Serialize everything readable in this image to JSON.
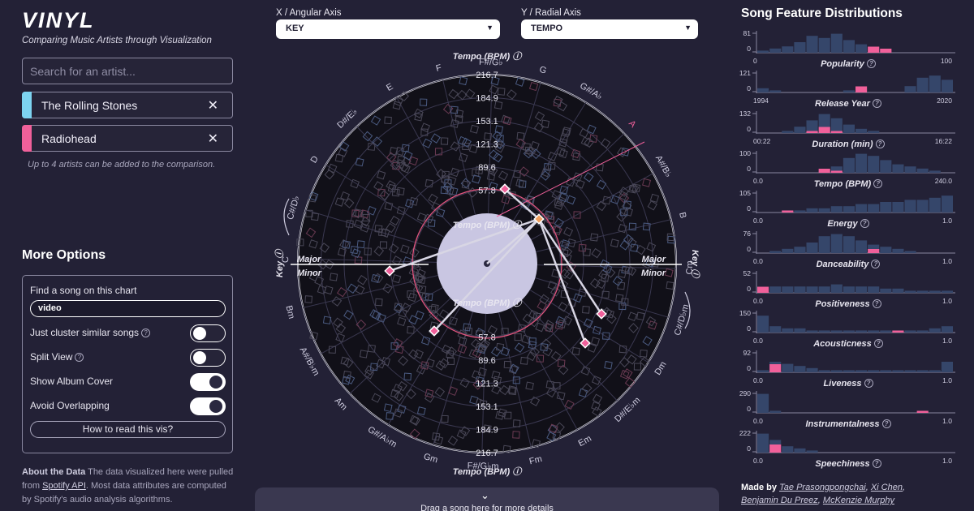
{
  "app": {
    "title": "VINYL",
    "subtitle": "Comparing Music Artists through Visualization"
  },
  "search": {
    "placeholder": "Search for an artist..."
  },
  "artists": [
    {
      "name": "The Rolling Stones",
      "color": "#7dd3f0",
      "remove": "✕"
    },
    {
      "name": "Radiohead",
      "color": "#f0609a",
      "remove": "✕"
    }
  ],
  "artist_hint": "Up to 4 artists can be added to the comparison.",
  "options": {
    "title": "More Options",
    "find_label": "Find a song on this chart",
    "find_value": "video",
    "toggles": [
      {
        "label": "Just cluster similar songs",
        "on": false,
        "help": true
      },
      {
        "label": "Split View",
        "on": false,
        "help": true
      },
      {
        "label": "Show Album Cover",
        "on": true,
        "help": false
      },
      {
        "label": "Avoid Overlapping",
        "on": true,
        "help": false
      }
    ],
    "how_button": "How to read this vis?"
  },
  "about": {
    "heading": "About the Data",
    "text1": "The data visualized here were pulled from",
    "link": "Spotify API",
    "text2": ". Most data attributes are computed by Spotify's audio analysis algorithms."
  },
  "axes": {
    "x_label": "X / Angular Axis",
    "x_value": "KEY",
    "y_label": "Y / Radial Axis",
    "y_value": "TEMPO"
  },
  "chart_data": {
    "type": "scatter",
    "radial_axis": "Tempo (BPM)",
    "angular_axis": "Key",
    "radial_ticks": [
      "57.8",
      "89.6",
      "121.3",
      "153.1",
      "184.9",
      "216.7"
    ],
    "keys": [
      "F#/G♭",
      "G",
      "G#/A♭",
      "A",
      "A#/B♭",
      "B",
      "Cm",
      "C#/D♭m",
      "Dm",
      "D#/E♭m",
      "Em",
      "Fm",
      "F#/G♭m",
      "Gm",
      "G#/A♭m",
      "Am",
      "A#/B♭m",
      "Bm",
      "C",
      "C#/D♭",
      "D",
      "D#/E♭",
      "E",
      "F"
    ],
    "highlighted_key": "A",
    "mode_labels": {
      "major": "Major",
      "minor": "Minor"
    },
    "axis_title": "Key"
  },
  "bottom_panel": {
    "chevron": "⌄",
    "text": "Drag a song here for more details"
  },
  "distributions": {
    "title": "Song Feature Distributions",
    "items": [
      {
        "label": "Popularity",
        "ymax": "81",
        "y0": "0",
        "xmin": "0",
        "xmax": "100"
      },
      {
        "label": "Release Year",
        "ymax": "121",
        "y0": "0",
        "xmin": "1994",
        "xmax": "2020"
      },
      {
        "label": "Duration (min)",
        "ymax": "132",
        "y0": "0",
        "xmin": "00:22",
        "xmax": "16:22"
      },
      {
        "label": "Tempo (BPM)",
        "ymax": "100",
        "y0": "0",
        "xmin": "0.0",
        "xmax": "240.0"
      },
      {
        "label": "Energy",
        "ymax": "105",
        "y0": "0",
        "xmin": "0.0",
        "xmax": "1.0"
      },
      {
        "label": "Danceability",
        "ymax": "76",
        "y0": "0",
        "xmin": "0.0",
        "xmax": "1.0"
      },
      {
        "label": "Positiveness",
        "ymax": "52",
        "y0": "0",
        "xmin": "0.0",
        "xmax": "1.0"
      },
      {
        "label": "Acousticness",
        "ymax": "150",
        "y0": "0",
        "xmin": "0.0",
        "xmax": "1.0"
      },
      {
        "label": "Liveness",
        "ymax": "92",
        "y0": "0",
        "xmin": "0.0",
        "xmax": "1.0"
      },
      {
        "label": "Instrumentalness",
        "ymax": "290",
        "y0": "0",
        "xmin": "0.0",
        "xmax": "1.0"
      },
      {
        "label": "Speechiness",
        "ymax": "222",
        "y0": "0",
        "xmin": "0.0",
        "xmax": "1.0"
      }
    ]
  },
  "credits": {
    "prefix": "Made by",
    "authors": [
      "Tae Prasongpongchai",
      "Xi Chen",
      "Benjamin Du Preez",
      "McKenzie Murphy"
    ]
  },
  "colors": {
    "background": "#232136",
    "stones": "#7dd3f0",
    "radiohead": "#f0609a",
    "dot": "#5a5870"
  }
}
